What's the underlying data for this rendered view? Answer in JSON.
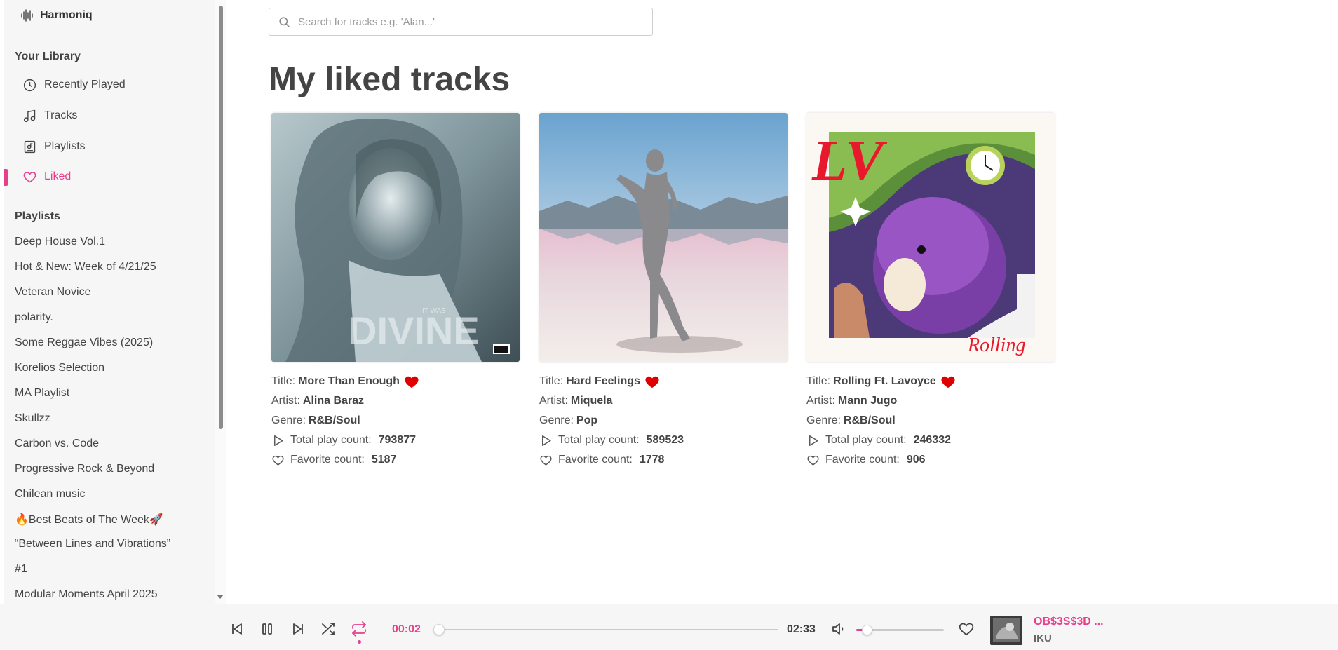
{
  "app": {
    "name": "Harmoniq"
  },
  "sidebar": {
    "library_title": "Your Library",
    "nav": [
      {
        "label": "Recently Played",
        "icon": "clock-icon"
      },
      {
        "label": "Tracks",
        "icon": "music-note-icon"
      },
      {
        "label": "Playlists",
        "icon": "playlist-icon"
      },
      {
        "label": "Liked",
        "icon": "heart-icon",
        "active": true
      }
    ],
    "playlists_title": "Playlists",
    "playlists": [
      "Deep House Vol.1",
      "Hot & New: Week of 4/21/25",
      "Veteran Novice",
      "polarity.",
      "Some Reggae Vibes (2025)",
      "Korelios Selection",
      "MA Playlist",
      "Skullzz",
      "Carbon vs. Code",
      "Progressive Rock & Beyond",
      "Chilean music",
      "🔥Best Beats of The Week🚀",
      "“Between Lines and Vibrations”",
      "#1",
      "Modular Moments April 2025"
    ]
  },
  "search": {
    "placeholder": "Search for tracks e.g. 'Alan...'"
  },
  "main": {
    "title": "My liked tracks",
    "labels": {
      "title": "Title:",
      "artist": "Artist:",
      "genre": "Genre:",
      "plays": "Total play count:",
      "favorites": "Favorite count:"
    },
    "tracks": [
      {
        "title": "More Than Enough",
        "artist": "Alina Baraz",
        "genre": "R&B/Soul",
        "plays": "793877",
        "favorites": "5187",
        "cover_text": "DIVINE",
        "cover_small": "IT WAS"
      },
      {
        "title": "Hard Feelings",
        "artist": "Miquela",
        "genre": "Pop",
        "plays": "589523",
        "favorites": "1778"
      },
      {
        "title": "Rolling Ft. Lavoyce",
        "artist": "Mann Jugo",
        "genre": "R&B/Soul",
        "plays": "246332",
        "favorites": "906",
        "cover_text": "LV",
        "cover_script": "Rolling"
      }
    ]
  },
  "player": {
    "current_time": "00:02",
    "total_time": "02:33",
    "progress": 0.013,
    "volume": 0.12,
    "repeat_active": true,
    "track_title": "OB$3S$3D ...",
    "track_artist": "IKU",
    "accent": "#e83e8c"
  }
}
